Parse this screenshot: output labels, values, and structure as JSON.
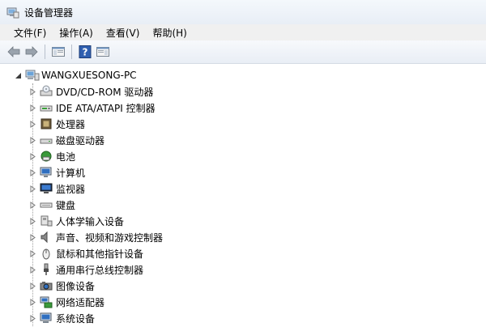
{
  "window": {
    "title": "设备管理器"
  },
  "menu": [
    "文件(F)",
    "操作(A)",
    "查看(V)",
    "帮助(H)"
  ],
  "tree": {
    "root": "WANGXUESONG-PC",
    "items": [
      {
        "label": "DVD/CD-ROM 驱动器",
        "icon": "dvd-drive-icon"
      },
      {
        "label": "IDE ATA/ATAPI 控制器",
        "icon": "ide-controller-icon"
      },
      {
        "label": "处理器",
        "icon": "processor-icon"
      },
      {
        "label": "磁盘驱动器",
        "icon": "disk-drive-icon"
      },
      {
        "label": "电池",
        "icon": "battery-icon"
      },
      {
        "label": "计算机",
        "icon": "computer-icon"
      },
      {
        "label": "监视器",
        "icon": "monitor-icon"
      },
      {
        "label": "键盘",
        "icon": "keyboard-icon"
      },
      {
        "label": "人体学输入设备",
        "icon": "hid-icon"
      },
      {
        "label": "声音、视频和游戏控制器",
        "icon": "speaker-icon"
      },
      {
        "label": "鼠标和其他指针设备",
        "icon": "mouse-icon"
      },
      {
        "label": "通用串行总线控制器",
        "icon": "usb-icon"
      },
      {
        "label": "图像设备",
        "icon": "camera-icon"
      },
      {
        "label": "网络适配器",
        "icon": "network-adapter-icon"
      },
      {
        "label": "系统设备",
        "icon": "system-devices-icon"
      }
    ]
  }
}
